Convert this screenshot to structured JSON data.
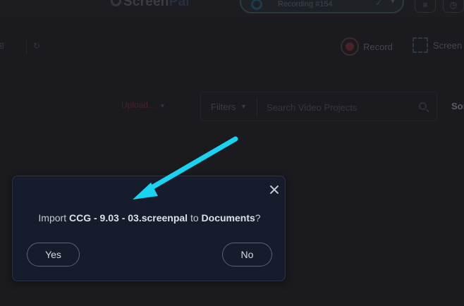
{
  "app": {
    "logo_prefix": "Screen",
    "logo_suffix": "Pal",
    "recording_title": "Recording #154",
    "logo_icon": "screenpal-logo-icon"
  },
  "toolbar": {
    "record_label": "Record",
    "screen_label": "Screen"
  },
  "filters": {
    "sort_select_label": "Upload...",
    "filters_label": "Filters",
    "search_placeholder": "Search Video Projects",
    "sort_label": "Sor"
  },
  "dialog": {
    "message_prefix": "Import ",
    "file_name": "CCG - 9.03 - 03.screenpal",
    "message_middle": " to ",
    "destination": "Documents",
    "message_suffix": "?",
    "yes_label": "Yes",
    "no_label": "No"
  },
  "annotation": {
    "arrow_color": "#19d3f0"
  },
  "colors": {
    "background": "#1b1b1f",
    "dialog_background": "#161c2c",
    "dialog_border": "#2a3448"
  }
}
